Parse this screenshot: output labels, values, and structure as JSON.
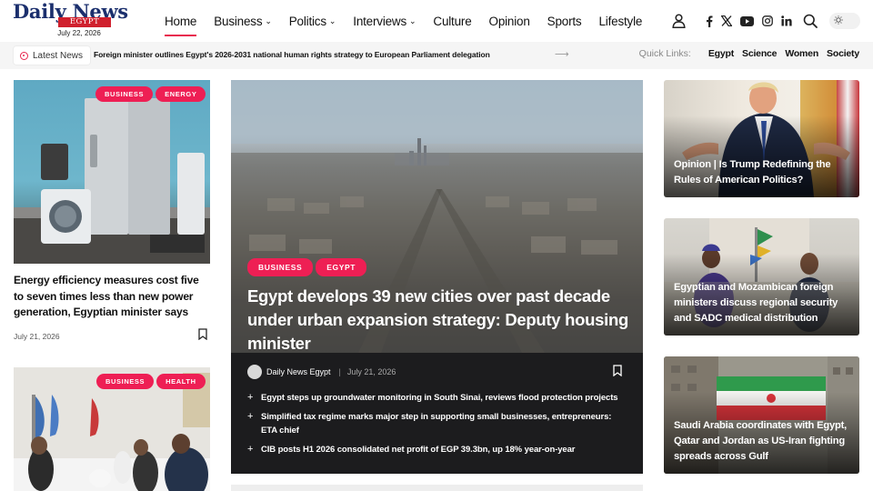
{
  "header": {
    "logo_text": "Daily News",
    "logo_badge": "EGYPT",
    "date": "July 22, 2026",
    "nav": [
      {
        "label": "Home",
        "active": true,
        "dropdown": false
      },
      {
        "label": "Business",
        "dropdown": true
      },
      {
        "label": "Politics",
        "dropdown": true
      },
      {
        "label": "Interviews",
        "dropdown": true
      },
      {
        "label": "Culture",
        "dropdown": false
      },
      {
        "label": "Opinion",
        "dropdown": false
      },
      {
        "label": "Sports",
        "dropdown": false
      },
      {
        "label": "Lifestyle",
        "dropdown": false
      }
    ],
    "icons": [
      "user-icon",
      "facebook-icon",
      "x-icon",
      "youtube-icon",
      "instagram-icon",
      "linkedin-icon",
      "search-icon",
      "theme-toggle-icon"
    ]
  },
  "ticker": {
    "label": "Latest News",
    "headline": "Foreign minister outlines Egypt's 2026-2031 national human rights strategy to European Parliament delegation",
    "quick_links_label": "Quick Links:",
    "quick_links": [
      "Egypt",
      "Science",
      "Women",
      "Society"
    ]
  },
  "left": {
    "card1": {
      "tags": [
        "BUSINESS",
        "ENERGY"
      ],
      "title": "Energy efficiency measures cost five to seven times less than new power generation, Egyptian minister says",
      "date": "July 21, 2026"
    },
    "card2": {
      "tags": [
        "BUSINESS",
        "HEALTH"
      ]
    }
  },
  "feature": {
    "tags": [
      "BUSINESS",
      "EGYPT"
    ],
    "title": "Egypt develops 39 new cities over past decade under urban expansion strategy: Deputy housing minister",
    "author": "Daily News Egypt",
    "date": "July 21, 2026",
    "related": [
      "Egypt steps up groundwater monitoring in South Sinai, reviews flood protection projects",
      "Simplified tax regime marks major step in supporting small businesses, entrepreneurs: ETA chief",
      "CIB posts H1 2026 consolidated net profit of EGP 39.3bn, up 18% year-on-year"
    ]
  },
  "right": {
    "card1": {
      "title": "Opinion | Is Trump Redefining the Rules of American Politics?"
    },
    "card2": {
      "title": "Egyptian and Mozambican foreign ministers discuss regional security and SADC medical distribution"
    },
    "card3": {
      "title": "Saudi Arabia coordinates with Egypt, Qatar and Jordan as US-Iran fighting spreads across Gulf"
    }
  },
  "colors": {
    "accent": "#ee1f54",
    "logo_blue": "#1b2f6d",
    "logo_red": "#d0202d",
    "feature_bg": "#1c1c1e"
  }
}
